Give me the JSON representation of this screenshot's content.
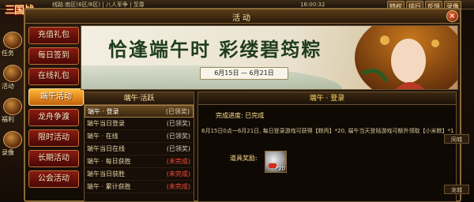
{
  "top": {
    "logo": "三国战",
    "info_left": "线路:南区(6区/8区) | 八人军争 | 至尊",
    "clock": "16:00:32",
    "buttons": [
      "特权",
      "排行",
      "反馈",
      "录像"
    ]
  },
  "left_hud": [
    "任务",
    "活动",
    "福利",
    "录像"
  ],
  "panel": {
    "title": "活动",
    "close_label": "×"
  },
  "menu": [
    {
      "label": "充值礼包",
      "active": false
    },
    {
      "label": "每日签到",
      "active": false
    },
    {
      "label": "在线礼包",
      "active": false
    },
    {
      "label": "端午活动",
      "active": true
    },
    {
      "label": "龙舟争渡",
      "active": false
    },
    {
      "label": "限时活动",
      "active": false
    },
    {
      "label": "长期活动",
      "active": false
    },
    {
      "label": "公会活动",
      "active": false
    }
  ],
  "banner": {
    "title": "恰逢端午时 彩缕碧筠粽",
    "date": "6月15日 — 6月21日"
  },
  "sublist": {
    "header": "端午·活跃",
    "rows": [
      {
        "name": "端午 · 登录",
        "status": "(已领奖)",
        "state": "done"
      },
      {
        "name": "端午当日登录",
        "status": "(已领奖)",
        "state": "done"
      },
      {
        "name": "端午 · 在线",
        "status": "(已领奖)",
        "state": "done"
      },
      {
        "name": "端午当日在线",
        "status": "(已领奖)",
        "state": "done"
      },
      {
        "name": "端午 · 每日获胜",
        "status": "(未完成)",
        "state": "undone"
      },
      {
        "name": "端午当日获胜",
        "status": "(未完成)",
        "state": "undone"
      },
      {
        "name": "端午 · 累计获胜",
        "status": "(未完成)",
        "state": "undone"
      }
    ]
  },
  "detail": {
    "header": "端午 · 登录",
    "progress": "完成进度: 已完成",
    "description": "6月15日0点一6月21日, 每日登录游戏可获得【粽丙】*20, 端午当天登陆游戏可额外领取【小米粽】*1",
    "reward_label": "道具奖励:",
    "reward_count": "*20"
  },
  "right_strip": [
    "同城",
    "",
    "",
    "龙城"
  ]
}
